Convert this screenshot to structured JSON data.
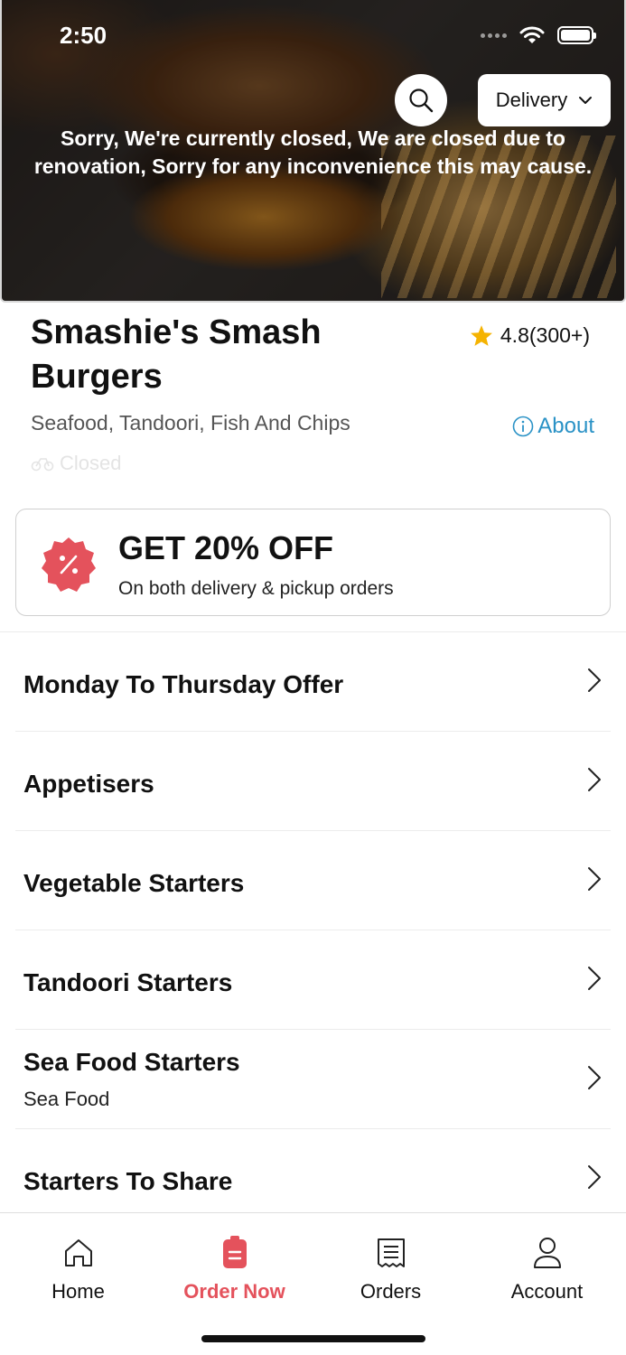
{
  "status_bar": {
    "time": "2:50"
  },
  "header": {
    "order_mode": "Delivery",
    "closed_message": "Sorry, We're currently closed, We are closed due to renovation, Sorry for any inconvenience this may cause."
  },
  "restaurant": {
    "name": "Smashie's Smash Burgers",
    "rating": "4.8(300+)",
    "cuisine": "Seafood, Tandoori, Fish And Chips",
    "about_label": "About",
    "status": "Closed"
  },
  "offer": {
    "title": "GET 20% OFF",
    "subtitle": "On both delivery & pickup orders"
  },
  "menu": {
    "categories": [
      {
        "title": "Monday To Thursday Offer",
        "subtitle": ""
      },
      {
        "title": "Appetisers",
        "subtitle": ""
      },
      {
        "title": "Vegetable Starters",
        "subtitle": ""
      },
      {
        "title": "Tandoori Starters",
        "subtitle": ""
      },
      {
        "title": "Sea Food Starters",
        "subtitle": "Sea Food"
      },
      {
        "title": "Starters To Share",
        "subtitle": ""
      }
    ]
  },
  "bottom_nav": {
    "items": [
      {
        "label": "Home",
        "icon": "home-icon"
      },
      {
        "label": "Order Now",
        "icon": "order-icon",
        "active": true
      },
      {
        "label": "Orders",
        "icon": "receipt-icon"
      },
      {
        "label": "Account",
        "icon": "user-icon"
      }
    ]
  },
  "colors": {
    "accent": "#e4525c",
    "link": "#2a92c6",
    "star": "#f5b301"
  }
}
